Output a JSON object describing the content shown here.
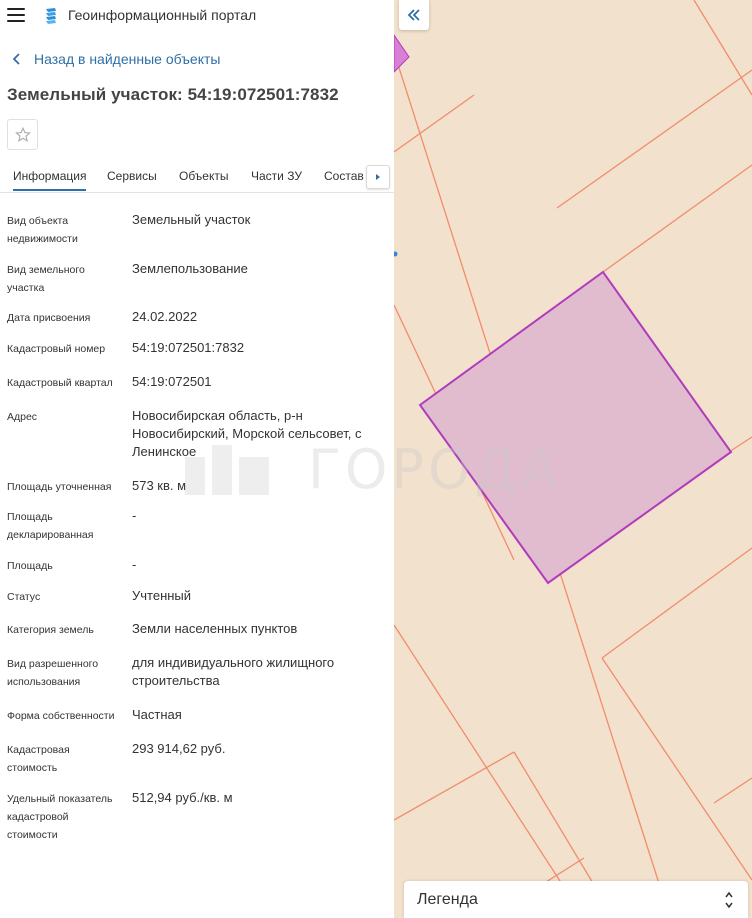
{
  "header": {
    "title": "Геоинформационный портал",
    "menu_icon": "hamburger-menu-icon",
    "logo_icon": "portal-logo-icon"
  },
  "nav": {
    "back_label": "Назад в найденные объекты"
  },
  "object": {
    "title": "Земельный участок: 54:19:072501:7832"
  },
  "tabs": [
    {
      "label": "Информация",
      "active": true
    },
    {
      "label": "Сервисы",
      "active": false
    },
    {
      "label": "Объекты",
      "active": false
    },
    {
      "label": "Части ЗУ",
      "active": false
    },
    {
      "label": "Состав",
      "active": false
    }
  ],
  "properties": [
    {
      "label": "Вид объекта недвижимости",
      "value": "Земельный участок"
    },
    {
      "label": "Вид земельного участка",
      "value": "Землепользование"
    },
    {
      "label": "Дата присвоения",
      "value": "24.02.2022"
    },
    {
      "label": "Кадастровый номер",
      "value": "54:19:072501:7832"
    },
    {
      "label": "Кадастровый квартал",
      "value": "54:19:072501"
    },
    {
      "label": "Адрес",
      "value": "Новосибирская область, р-н Новосибирский, Морской сельсовет, с Ленинское"
    },
    {
      "label": "Площадь уточненная",
      "value": "573 кв. м"
    },
    {
      "label": "Площадь декларированная",
      "value": "-"
    },
    {
      "label": "Площадь",
      "value": "-"
    },
    {
      "label": "Статус",
      "value": "Учтенный"
    },
    {
      "label": "Категория земель",
      "value": "Земли населенных пунктов"
    },
    {
      "label": "Вид разрешенного использования",
      "value": "для индивидуального жилищного строительства"
    },
    {
      "label": "Форма собственности",
      "value": "Частная"
    },
    {
      "label": "Кадастровая стоимость",
      "value": "293 914,62 руб."
    },
    {
      "label": "Удельный показатель кадастровой стоимости",
      "value": "512,94 руб./кв. м"
    }
  ],
  "watermark": {
    "text": "ГОРОДА"
  },
  "legend": {
    "label": "Легенда"
  },
  "colors": {
    "map_background": "#f2e1cc",
    "parcel_border": "#f08d6e",
    "selected_fill": "#e0bcce",
    "selected_stroke": "#b03cbc",
    "accent": "#2f6fa7"
  }
}
